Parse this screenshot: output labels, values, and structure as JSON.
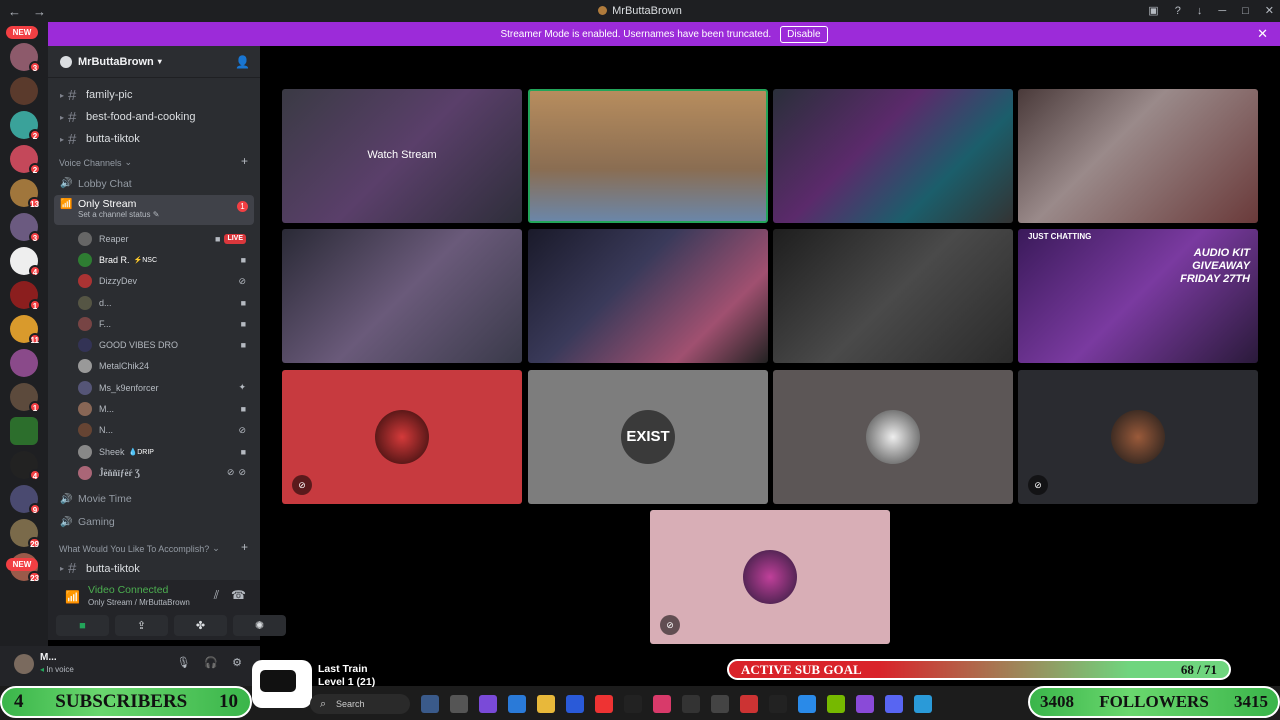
{
  "window": {
    "title": "MrButtaBrown",
    "back": "←",
    "forward": "→"
  },
  "banner": {
    "text": "Streamer Mode is enabled. Usernames have been truncated.",
    "disable": "Disable",
    "close": "✕"
  },
  "rail": {
    "new_top": "NEW",
    "new_bottom": "NEW",
    "badges": [
      "3",
      "",
      "2",
      "2",
      "13",
      "3",
      "4",
      "1",
      "11",
      "1",
      "1",
      "",
      "4",
      "9",
      "29",
      "23"
    ]
  },
  "server": {
    "name": "MrButtaBrown"
  },
  "channels": {
    "text": [
      {
        "name": "family-pic"
      },
      {
        "name": "best-food-and-cooking"
      },
      {
        "name": "butta-tiktok"
      }
    ],
    "voice_category": "Voice Channels",
    "lobby": "Lobby Chat",
    "active": {
      "name": "Only Stream",
      "status": "Set a channel status",
      "count": "1"
    },
    "users": [
      {
        "name": "Reaper",
        "live": "LIVE"
      },
      {
        "name": "Brad R.",
        "tag": "⚡NSC"
      },
      {
        "name": "DizzyDev"
      },
      {
        "name": "d..."
      },
      {
        "name": "F..."
      },
      {
        "name": "GOOD VIBES DRO"
      },
      {
        "name": "MetalChik24"
      },
      {
        "name": "Ms_k9enforcer"
      },
      {
        "name": "M..."
      },
      {
        "name": "N..."
      },
      {
        "name": "Sheek",
        "tag": "💧DRIP"
      },
      {
        "name": "Ĵĕňňīƒĕŕ Ʒ"
      }
    ],
    "movie": "Movie Time",
    "gaming": "Gaming",
    "category2": "What Would You Like To Accomplish?",
    "bottom_text": "butta-tiktok"
  },
  "voice_panel": {
    "status": "Video Connected",
    "location": "Only Stream / MrButtaBrown"
  },
  "user_panel": {
    "name": "M...",
    "status": "In voice"
  },
  "grid": {
    "watch_stream": "Watch Stream",
    "just_chatting": "JUST CHATTING",
    "giveaway": "AUDIO KIT GIVEAWAY FRIDAY 27TH",
    "exist_label": "EXIST"
  },
  "overlay": {
    "subs_label": "SUBSCRIBERS",
    "subs_current": "4",
    "subs_goal": "10",
    "followers_label": "FOLLOWERS",
    "followers_current": "3408",
    "followers_goal": "3415",
    "sub_goal_label": "ACTIVE SUB GOAL",
    "sub_goal_value": "68 / 71",
    "track": "Last Train",
    "level": "Level 1 (21)"
  },
  "taskbar": {
    "search": "Search"
  },
  "colors": {
    "accent": "#9c2bd9",
    "live": "#da373c",
    "connected": "#23a55a"
  }
}
